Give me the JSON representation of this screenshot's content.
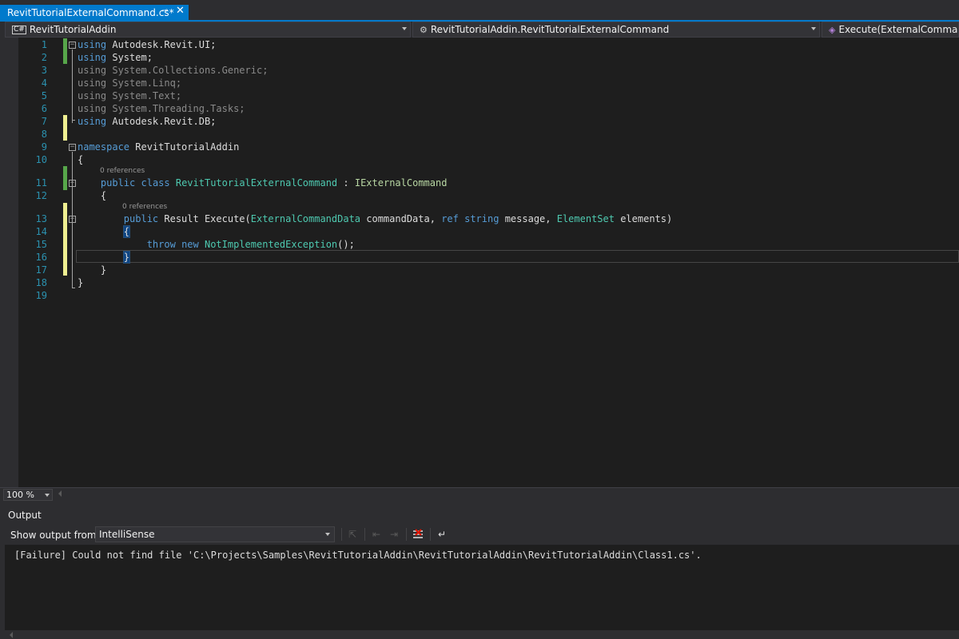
{
  "tab": {
    "title": "RevitTutorialExternalCommand.cs*",
    "pin_glyph": "⊸",
    "close_glyph": "✕"
  },
  "navbar": {
    "project": "RevitTutorialAddin",
    "project_icon": "C#",
    "type": "RevitTutorialAddin.RevitTutorialExternalCommand",
    "member": "Execute(ExternalCommandData"
  },
  "editor": {
    "line_numbers": [
      "1",
      "2",
      "3",
      "4",
      "5",
      "6",
      "7",
      "8",
      "9",
      "10",
      "11",
      "12",
      "13",
      "14",
      "15",
      "16",
      "17",
      "18",
      "19"
    ],
    "codelens": {
      "class_refs": "0 references",
      "method_refs": "0 references"
    },
    "lines": {
      "l1": {
        "kw": "using",
        "rest": " Autodesk.Revit.UI;"
      },
      "l2": {
        "kw": "using",
        "rest": " System;"
      },
      "l3": "using System.Collections.Generic;",
      "l4": "using System.Linq;",
      "l5": "using System.Text;",
      "l6": "using System.Threading.Tasks;",
      "l7": {
        "kw": "using",
        "rest": " Autodesk.Revit.DB;"
      },
      "l9": {
        "kw": "namespace",
        "rest": " RevitTutorialAddin"
      },
      "l10": "{",
      "l11": {
        "kw1": "public",
        "kw2": "class",
        "name": "RevitTutorialExternalCommand",
        "sep": " : ",
        "iface": "IExternalCommand"
      },
      "l12": "{",
      "l13": {
        "kw1": "public",
        "ret": " Result Execute(",
        "t1": "ExternalCommandData",
        "p1": " commandData, ",
        "kw2": "ref",
        "kw3": "string",
        "p2": " message, ",
        "t2": "ElementSet",
        "p3": " elements)"
      },
      "l14": "{",
      "l15": {
        "kw1": "throw",
        "kw2": "new",
        "type": "NotImplementedException",
        "rest": "();"
      },
      "l16": "}",
      "l17": "}",
      "l18": "}"
    }
  },
  "zoom": {
    "value": "100 %"
  },
  "output": {
    "title": "Output",
    "show_from_label": "Show output from:",
    "source": "IntelliSense",
    "message": "[Failure] Could not find file 'C:\\Projects\\Samples\\RevitTutorialAddin\\RevitTutorialAddin\\RevitTutorialAddin\\Class1.cs'."
  }
}
